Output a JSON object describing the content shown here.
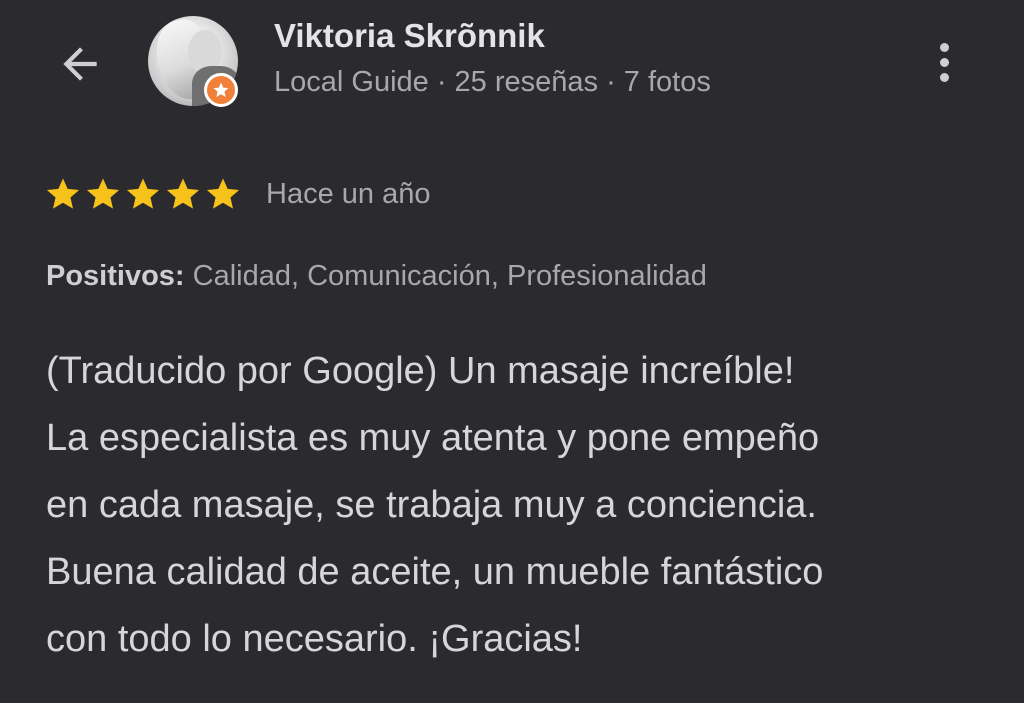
{
  "header": {
    "back_icon": "arrow-back-icon",
    "user_name": "Viktoria Skrõnnik",
    "user_meta": "Local Guide · 25 reseñas · 7 fotos",
    "more_icon": "more-vertical-icon",
    "badge_icon": "local-guide-star-icon",
    "badge_color": "#f0803a"
  },
  "review": {
    "rating": 5,
    "rating_max": 5,
    "star_color": "#f7c31a",
    "date": "Hace un año",
    "positives_label": "Positivos:",
    "positives_value": " Calidad, Comunicación, Profesionalidad",
    "text_lines": [
      "(Traducido por Google) Un masaje increíble!",
      "La especialista es muy atenta y pone empeño",
      "en cada masaje, se trabaja muy a conciencia.",
      "Buena calidad de aceite, un mueble fantástico",
      "con todo lo necesario. ¡Gracias!"
    ]
  },
  "colors": {
    "background": "#2b2b2f",
    "primary_text": "#d6d6d9",
    "secondary_text": "#a8a8ac"
  }
}
